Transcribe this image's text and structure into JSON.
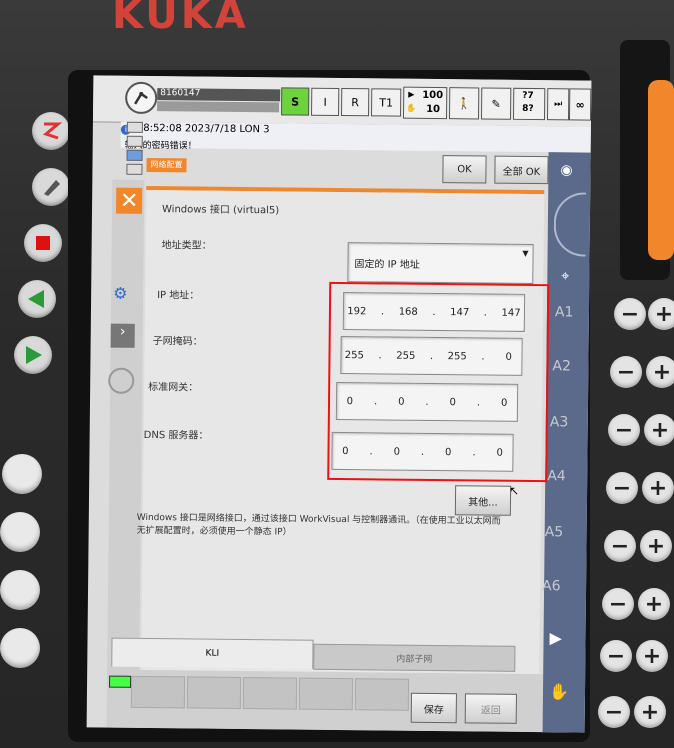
{
  "brand": "KUKA",
  "status": {
    "robot_id": "8160147",
    "mode_buttons": [
      "S",
      "I",
      "R",
      "T1"
    ],
    "speed_top": "100",
    "speed_bottom": "10",
    "info_time": "18:52:08 2023/7/18 LON 3",
    "info_message": "输入的密码错误！",
    "fraction_top": "?7",
    "fraction_bottom": "8?",
    "infinity": "∞"
  },
  "dialog": {
    "title": "网络配置",
    "ok_label": "OK",
    "all_ok_label": "全部 OK",
    "interface_title": "Windows 接口 (virtual5)",
    "address_type_label": "地址类型：",
    "address_type_value": "固定的 IP 地址",
    "ip_label": "IP 地址：",
    "ip": [
      "192",
      "168",
      "147",
      "147"
    ],
    "subnet_label": "子网掩码：",
    "subnet": [
      "255",
      "255",
      "255",
      "0"
    ],
    "gateway_label": "标准网关：",
    "gateway": [
      "0",
      "0",
      "0",
      "0"
    ],
    "dns_label": "DNS 服务器：",
    "dns": [
      "0",
      "0",
      "0",
      "0"
    ],
    "other_button": "其他...",
    "note": "Windows 接口是网络接口，通过该接口 WorkVisual 与控制器通讯。（在使用工业以太网而无扩展配置时，必须使用一个静态 IP）",
    "tab_kli": "KLI",
    "tab_internal": "内部子网",
    "save_button": "保存",
    "back_button": "返回"
  },
  "axes": [
    "A1",
    "A2",
    "A3",
    "A4",
    "A5",
    "A6"
  ],
  "colors": {
    "orange": "#f2862a",
    "red_highlight": "#e11111",
    "kuka_red": "#d2433a"
  }
}
